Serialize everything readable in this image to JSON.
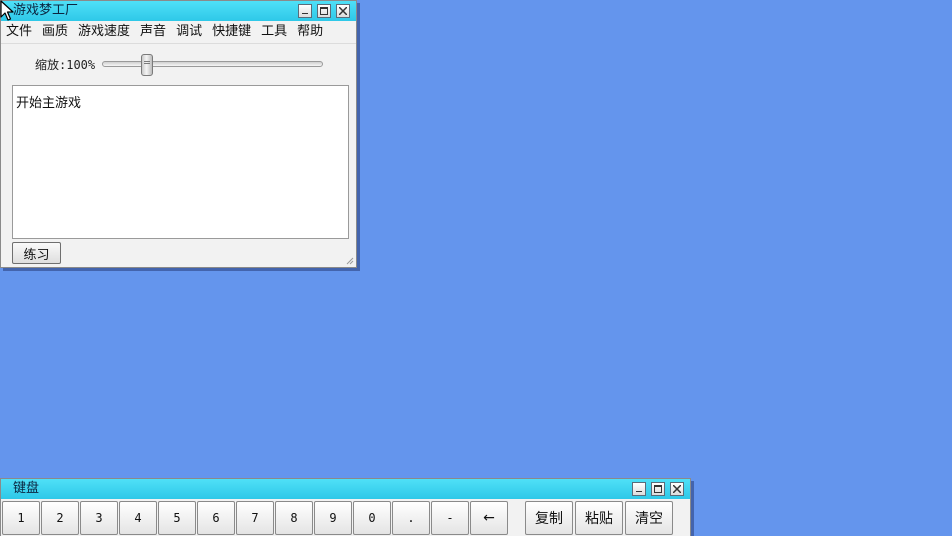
{
  "main_window": {
    "title": "游戏梦工厂",
    "menu": [
      "文件",
      "画质",
      "游戏速度",
      "声音",
      "调试",
      "快捷键",
      "工具",
      "帮助"
    ],
    "zoom_label": "缩放:100%",
    "zoom_value_percent": 100,
    "text_content": "开始主游戏",
    "practice_button": "练习"
  },
  "keyboard_window": {
    "title": "键盘",
    "keys": [
      "1",
      "2",
      "3",
      "4",
      "5",
      "6",
      "7",
      "8",
      "9",
      "0",
      ".",
      "-",
      "←"
    ],
    "actions": [
      "复制",
      "粘贴",
      "清空"
    ]
  },
  "icons": {
    "minimize": "minimize-icon",
    "maximize": "maximize-icon",
    "close": "close-icon",
    "cursor": "mouse-pointer-icon"
  },
  "colors": {
    "desktop": "#6495ed",
    "titlebar": "#3dd4f0",
    "window_bg": "#f2f2f2"
  }
}
